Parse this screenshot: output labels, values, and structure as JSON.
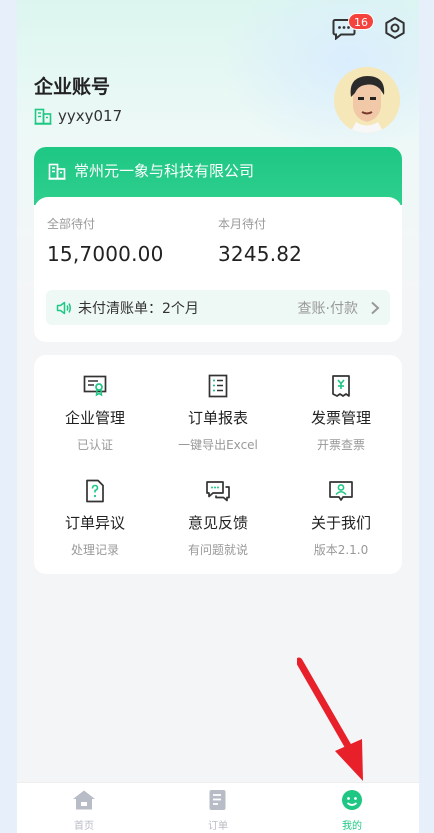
{
  "header": {
    "message_badge_count": "16"
  },
  "account": {
    "title": "企业账号",
    "id": "yyxy017"
  },
  "company": {
    "name": "常州元一象与科技有限公司",
    "stats": {
      "all_pending_label": "全部待付",
      "all_pending_value": "15,7000.00",
      "month_pending_label": "本月待付",
      "month_pending_value": "3245.82"
    },
    "unpaid": {
      "text": "未付清账单：2个月",
      "link": "查账·付款"
    }
  },
  "menu": [
    {
      "title": "企业管理",
      "sub": "已认证",
      "icon": "certificate-icon"
    },
    {
      "title": "订单报表",
      "sub": "一键导出Excel",
      "icon": "report-icon"
    },
    {
      "title": "发票管理",
      "sub": "开票查票",
      "icon": "invoice-icon"
    },
    {
      "title": "订单异议",
      "sub": "处理记录",
      "icon": "question-doc-icon"
    },
    {
      "title": "意见反馈",
      "sub": "有问题就说",
      "icon": "chat-bubbles-icon"
    },
    {
      "title": "关于我们",
      "sub": "版本2.1.0",
      "icon": "about-icon"
    }
  ],
  "tabbar": [
    {
      "label": "首页",
      "icon": "home-icon",
      "active": false
    },
    {
      "label": "订单",
      "icon": "orders-icon",
      "active": false
    },
    {
      "label": "我的",
      "icon": "profile-icon",
      "active": true
    }
  ],
  "colors": {
    "accent": "#1ec784",
    "badge": "#f5423d",
    "arrow": "#e8202a",
    "tab_inactive": "#b8bcc6"
  }
}
